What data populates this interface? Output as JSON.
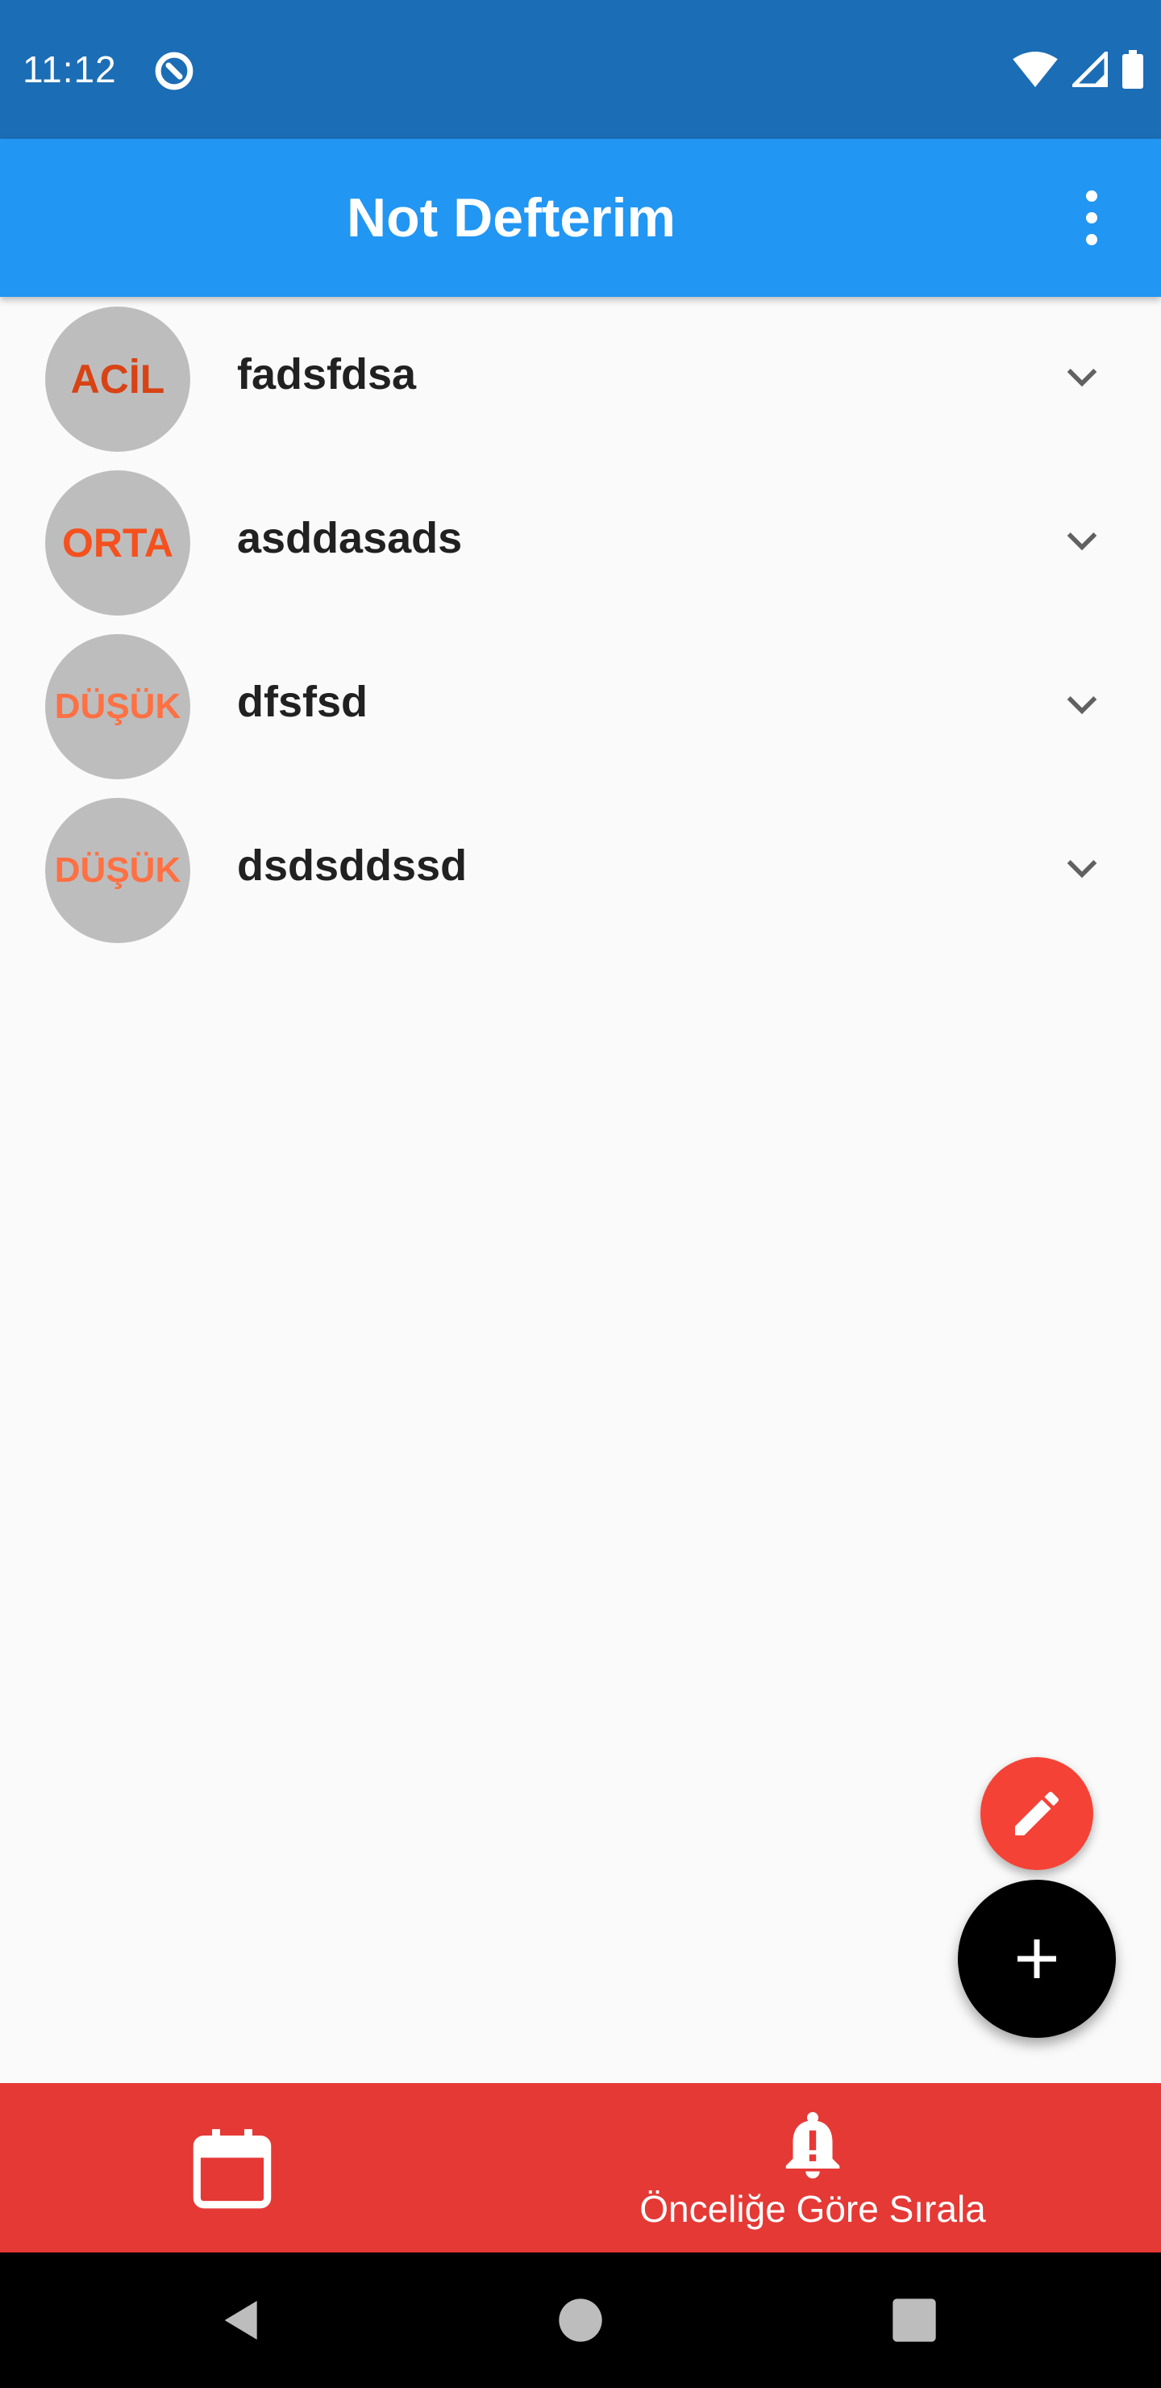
{
  "status_bar": {
    "time": "11:12",
    "icons": [
      "sync-disabled-icon",
      "wifi-icon",
      "cellular-signal-icon",
      "battery-icon"
    ]
  },
  "app_bar": {
    "title": "Not Defterim",
    "menu_icon": "more-vert-icon"
  },
  "notes": [
    {
      "priority": "ACİL",
      "priority_color": "#d84315",
      "title": "fadsfdsa"
    },
    {
      "priority": "ORTA",
      "priority_color": "#f4511e",
      "title": "asddasads"
    },
    {
      "priority": "DÜŞÜK",
      "priority_color": "#ff7043",
      "title": "dfsfsd"
    },
    {
      "priority": "DÜŞÜK",
      "priority_color": "#ff7043",
      "title": "dsdsddssd"
    }
  ],
  "fabs": {
    "edit_icon": "pencil-icon",
    "edit_color": "#f44336",
    "add_icon": "plus-icon",
    "add_color": "#000000"
  },
  "bottom_nav": {
    "calendar_icon": "calendar-icon",
    "priority_icon": "bell-alert-icon",
    "priority_label": "Önceliğe Göre Sırala",
    "background": "#e53935"
  },
  "system_nav": {
    "icons": [
      "back-icon",
      "home-icon",
      "recents-icon"
    ]
  },
  "colors": {
    "status_bar": "#1b6db5",
    "app_bar": "#2196f3",
    "background": "#fafafa",
    "avatar": "#bdbdbd"
  }
}
